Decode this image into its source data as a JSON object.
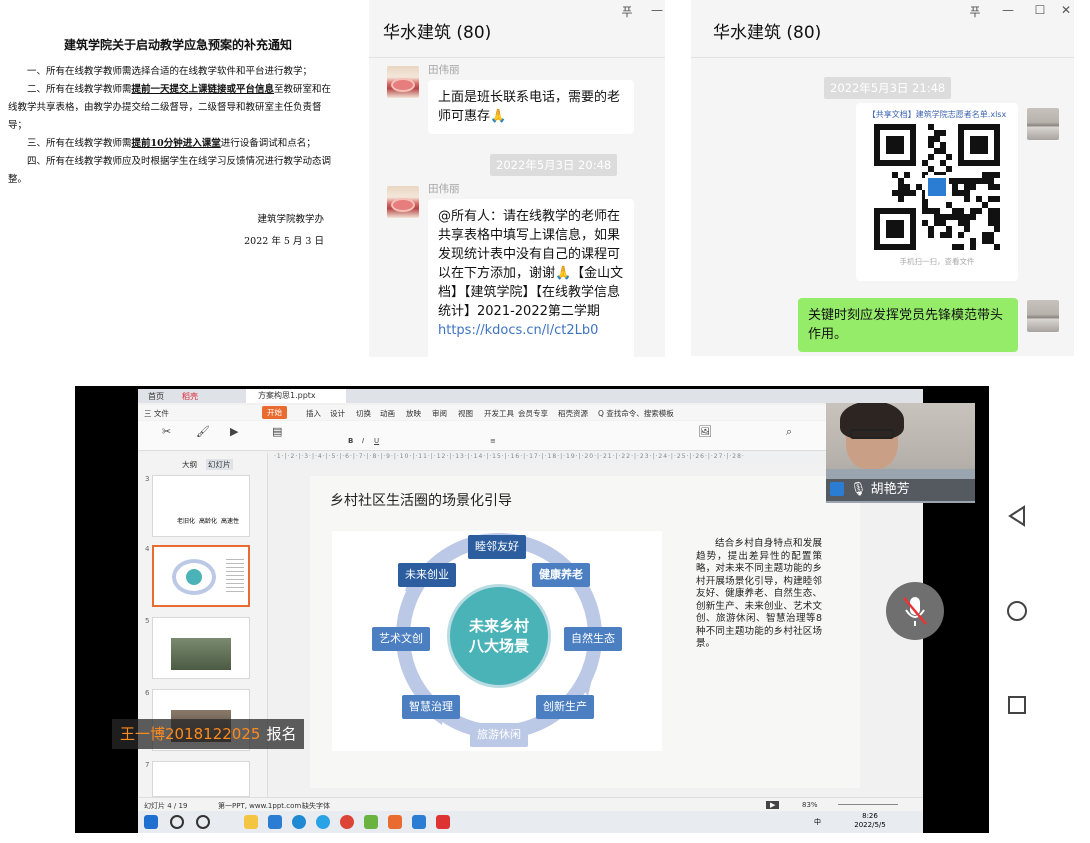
{
  "notice": {
    "title": "建筑学院关于启动教学应急预案的补充通知",
    "p1": "一、所有在线教学教师需选择合适的在线教学软件和平台进行教学；",
    "p2_a": "二、所有在线教学教师需",
    "p2_u": "提前一天提交上课链接或平台信息",
    "p2_b": "至教研室和在线教学共享表格，由教学办提交给二级督导，二级督导和教研室主任负责督导；",
    "p3_a": "三、所有在线教学教师需",
    "p3_u": "提前10分钟进入课堂",
    "p3_b": "进行设备调试和点名；",
    "p4": "四、所有在线教学教师应及时根据学生在线学习反馈情况进行教学动态调整。",
    "sign_org": "建筑学院教学办",
    "sign_date": "2022 年 5 月 3 日"
  },
  "chat_left": {
    "title": "华水建筑 (80)",
    "sender1": "田伟丽",
    "msg1": "上面是班长联系电话，需要的老师可惠存🙏",
    "time": "2022年5月3日 20:48",
    "sender2": "田伟丽",
    "msg2": "@所有人：请在线教学的老师在共享表格中填写上课信息，如果发现统计表中没有自己的课程可以在下方添加，谢谢🙏【金山文档】【建筑学院】【在线教学信息统计】2021-2022第二学期",
    "link": "https://kdocs.cn/l/ct2Lb0"
  },
  "chat_right": {
    "title": "华水建筑 (80)",
    "time": "2022年5月3日 21:48",
    "card_title": "【共享文档】建筑学院志愿者名单.xlsx",
    "card_hint": "手机扫一扫，查看文件",
    "msg": "关键时刻应发挥党员先锋模范带头作用。"
  },
  "window_buttons": {
    "pin": "푸",
    "min": "—",
    "max": "☐",
    "close": "✕"
  },
  "wps": {
    "tab_home": "首页",
    "tab_shell": "稻壳",
    "tab_file": "方案构思1.pptx",
    "menus": [
      "三 文件",
      "开始",
      "插入",
      "设计",
      "切换",
      "动画",
      "放映",
      "审阅",
      "视图",
      "开发工具",
      "会员专享",
      "稻壳资源",
      "Q 查找命令、搜索模板"
    ],
    "panel_tabs": [
      "大纲",
      "幻灯片"
    ],
    "slide_numbers": [
      "3",
      "4",
      "5",
      "6",
      "7"
    ],
    "thumb3_words": [
      "老旧化",
      "高龄化",
      "高速性"
    ],
    "status_left": "幻灯片 4 / 19",
    "status_theme": "第一PPT, www.1ppt.com",
    "status_font": "缺失字体",
    "status_zoom": "83%",
    "clock_time": "8:26",
    "clock_date": "2022/5/5",
    "ime": "中"
  },
  "slide": {
    "title": "乡村社区生活圈的场景化引导",
    "center_line1": "未来乡村",
    "center_line2": "八大场景",
    "nodes": [
      "睦邻友好",
      "健康养老",
      "自然生态",
      "创新生产",
      "旅游休闲",
      "智慧治理",
      "艺术文创",
      "未来创业"
    ],
    "text": "结合乡村自身特点和发展趋势，提出差异性的配置策略，对未来不同主题功能的乡村开展场景化引导，构建睦邻友好、健康养老、自然生态、创新生产、未来创业、艺术文创、旅游休闲、智慧治理等8种不同主题功能的乡村社区场景。"
  },
  "call": {
    "camera_name": "胡艳芳",
    "student_name": "王一博2018122025",
    "student_tag": "报名"
  },
  "colors": {
    "accent_orange": "#e96b2f",
    "chat_green": "#95ec69",
    "node_dark": "#2c5d9e",
    "node_blue": "#4b7fc2",
    "ring": "#bcc9e6"
  }
}
